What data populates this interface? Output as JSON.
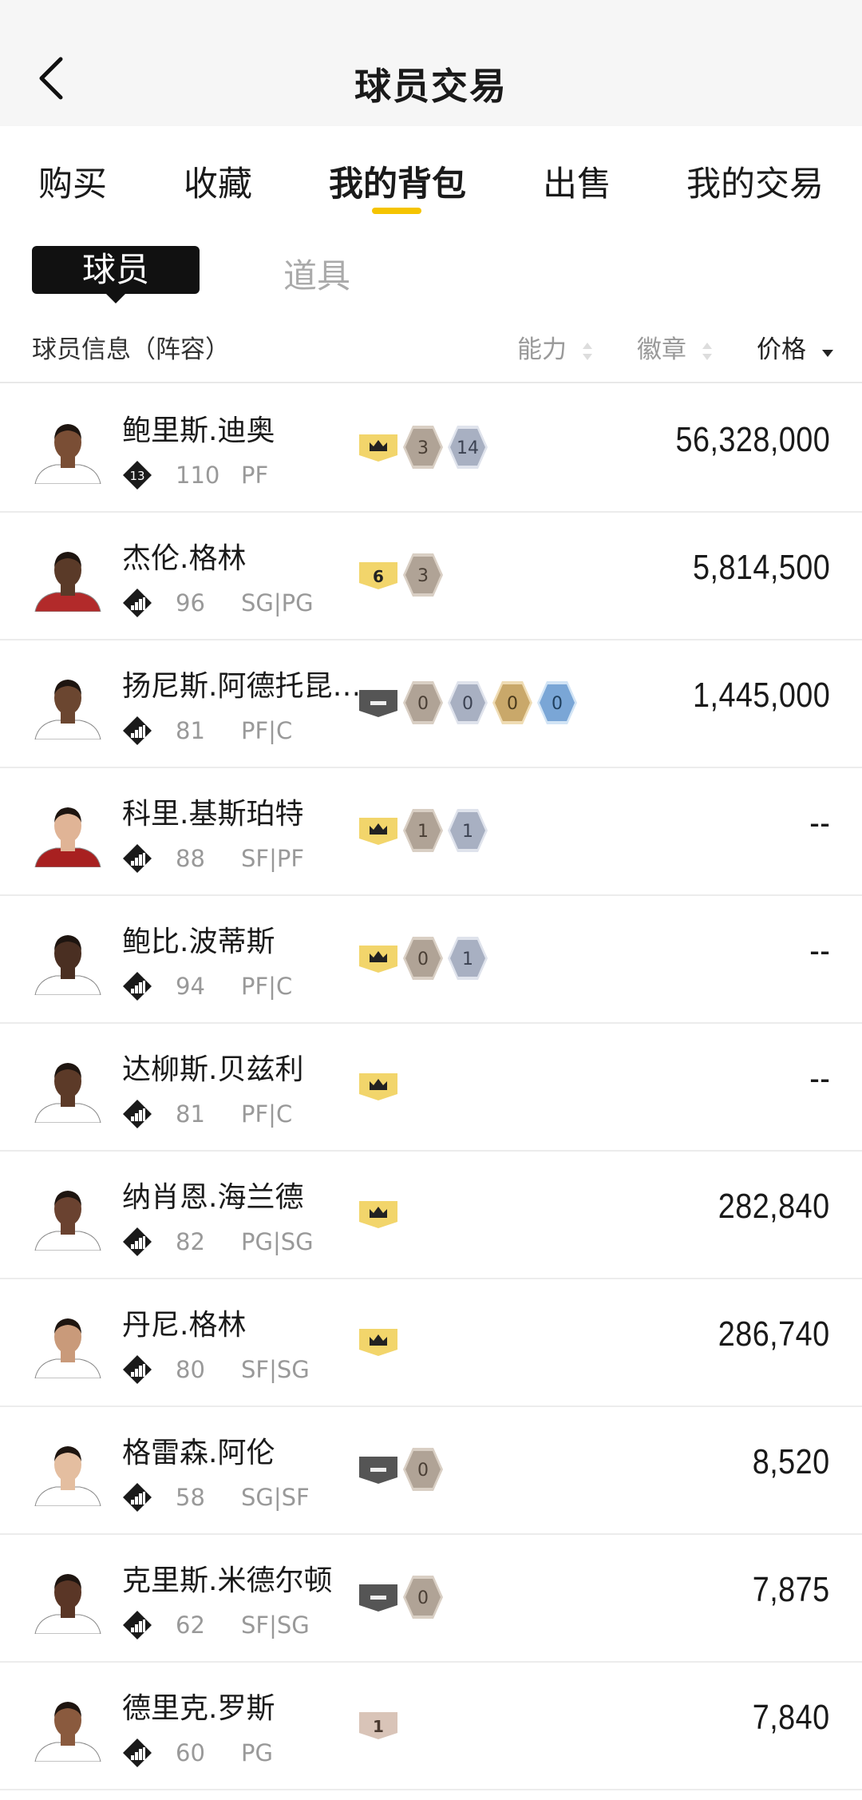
{
  "header": {
    "title": "球员交易"
  },
  "tabs": [
    {
      "label": "购买"
    },
    {
      "label": "收藏"
    },
    {
      "label": "我的背包",
      "active": true
    },
    {
      "label": "出售"
    },
    {
      "label": "我的交易"
    }
  ],
  "subtabs": {
    "active": "球员",
    "other": "道具"
  },
  "columns": {
    "info": "球员信息（阵容）",
    "ability": "能力",
    "badge": "徽章",
    "price": "价格"
  },
  "colors": {
    "accent": "#f5c400",
    "gold_badge": "#f2d56b",
    "bronze_hex": "#a89a8c",
    "silver_hex": "#aeb4c2"
  },
  "players": [
    {
      "name": "鲍里斯.迪奥",
      "rank": "13",
      "ovr": "110",
      "pos": "PF",
      "badges": [
        {
          "type": "crown"
        },
        {
          "type": "bronze",
          "n": "3"
        },
        {
          "type": "silver",
          "n": "14"
        }
      ],
      "price": "56,328,000"
    },
    {
      "name": "杰伦.格林",
      "rank": "bars",
      "ovr": "96",
      "pos": "SG|PG",
      "badges": [
        {
          "type": "gold",
          "n": "6"
        },
        {
          "type": "bronze",
          "n": "3"
        }
      ],
      "price": "5,814,500"
    },
    {
      "name": "扬尼斯.阿德托昆…",
      "rank": "bars",
      "ovr": "81",
      "pos": "PF|C",
      "badges": [
        {
          "type": "dark"
        },
        {
          "type": "bronze",
          "n": "0"
        },
        {
          "type": "silver",
          "n": "0"
        },
        {
          "type": "gold2",
          "n": "0"
        },
        {
          "type": "blue",
          "n": "0"
        }
      ],
      "price": "1,445,000"
    },
    {
      "name": "科里.基斯珀特",
      "rank": "bars",
      "ovr": "88",
      "pos": "SF|PF",
      "badges": [
        {
          "type": "crown"
        },
        {
          "type": "bronze",
          "n": "1"
        },
        {
          "type": "silver",
          "n": "1"
        }
      ],
      "price": "--"
    },
    {
      "name": "鲍比.波蒂斯",
      "rank": "bars",
      "ovr": "94",
      "pos": "PF|C",
      "badges": [
        {
          "type": "crown"
        },
        {
          "type": "bronze",
          "n": "0"
        },
        {
          "type": "silver",
          "n": "1"
        }
      ],
      "price": "--"
    },
    {
      "name": "达柳斯.贝兹利",
      "rank": "bars",
      "ovr": "81",
      "pos": "PF|C",
      "badges": [
        {
          "type": "crown"
        }
      ],
      "price": "--"
    },
    {
      "name": "纳肖恩.海兰德",
      "rank": "bars",
      "ovr": "82",
      "pos": "PG|SG",
      "badges": [
        {
          "type": "crown"
        }
      ],
      "price": "282,840"
    },
    {
      "name": "丹尼.格林",
      "rank": "bars",
      "ovr": "80",
      "pos": "SF|SG",
      "badges": [
        {
          "type": "crown"
        }
      ],
      "price": "286,740"
    },
    {
      "name": "格雷森.阿伦",
      "rank": "bars",
      "ovr": "58",
      "pos": "SG|SF",
      "badges": [
        {
          "type": "dark"
        },
        {
          "type": "bronze",
          "n": "0"
        }
      ],
      "price": "8,520"
    },
    {
      "name": "克里斯.米德尔顿",
      "rank": "bars",
      "ovr": "62",
      "pos": "SF|SG",
      "badges": [
        {
          "type": "dark"
        },
        {
          "type": "bronze",
          "n": "0"
        }
      ],
      "price": "7,875"
    },
    {
      "name": "德里克.罗斯",
      "rank": "bars",
      "ovr": "60",
      "pos": "PG",
      "badges": [
        {
          "type": "pink",
          "n": "1"
        }
      ],
      "price": "7,840"
    }
  ]
}
